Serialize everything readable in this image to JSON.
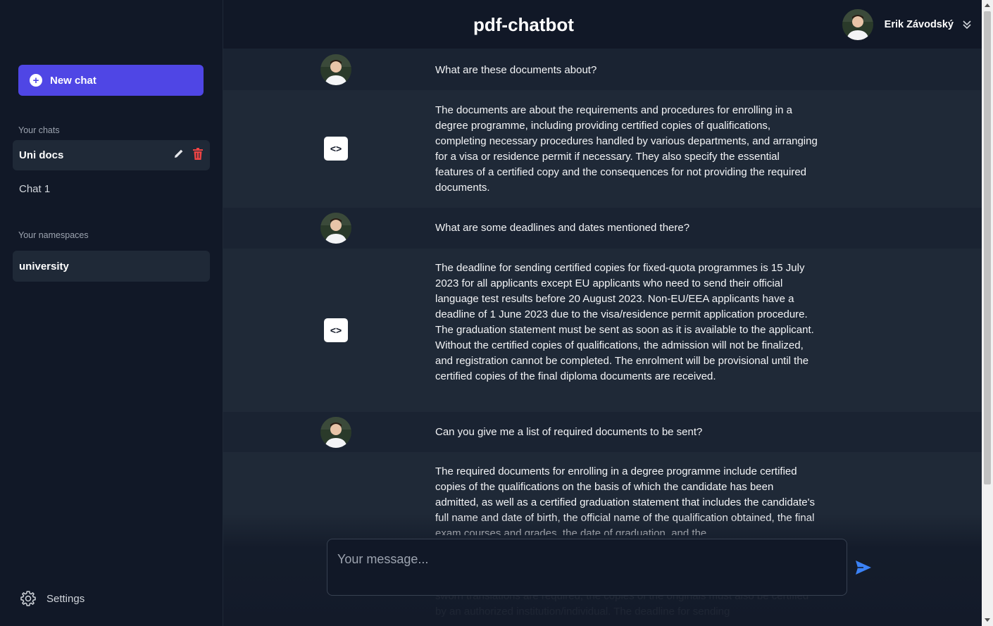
{
  "sidebar": {
    "new_chat_label": "New chat",
    "chats_label": "Your chats",
    "chats": [
      {
        "label": "Uni docs"
      },
      {
        "label": "Chat 1"
      }
    ],
    "namespaces_label": "Your namespaces",
    "namespaces": [
      {
        "label": "university"
      }
    ],
    "settings_label": "Settings"
  },
  "header": {
    "title": "pdf-chatbot",
    "user_name": "Erik Závodský"
  },
  "messages": [
    {
      "role": "user",
      "text": "What are these documents about?"
    },
    {
      "role": "bot",
      "text": "The documents are about the requirements and procedures for enrolling in a degree programme, including providing certified copies of qualifications, completing necessary procedures handled by various departments, and arranging for a visa or residence permit if necessary. They also specify the essential features of a certified copy and the consequences for not providing the required documents."
    },
    {
      "role": "user",
      "text": "What are some deadlines and dates mentioned there?"
    },
    {
      "role": "bot",
      "text": "The deadline for sending certified copies for fixed-quota programmes is 15 July 2023 for all applicants except EU applicants who need to send their official language test results before 20 August 2023. Non-EU/EEA applicants have a deadline of 1 June 2023 due to the visa/residence permit application procedure. The graduation statement must be sent as soon as it is available to the applicant. Without the certified copies of qualifications, the admission will not be finalized, and registration cannot be completed. The enrolment will be provisional until the certified copies of the final diploma documents are received."
    },
    {
      "role": "user",
      "text": "Can you give me a list of required documents to be sent?"
    },
    {
      "role": "bot",
      "text": "The required documents for enrolling in a degree programme include certified copies of the qualifications on the basis of which the candidate has been admitted, as well as a certified graduation statement that includes the candidate's full name and date of birth, the official name of the qualification obtained, the final exam courses and grades, the date of graduation, and the",
      "tail_text": "sworn translations are required, the copies of the originals must also be certified by an authorized institution/individual. The deadline for sending"
    }
  ],
  "input": {
    "placeholder": "Your message..."
  },
  "colors": {
    "accent": "#4f46e5",
    "send": "#3b82f6",
    "delete": "#ef4444"
  }
}
